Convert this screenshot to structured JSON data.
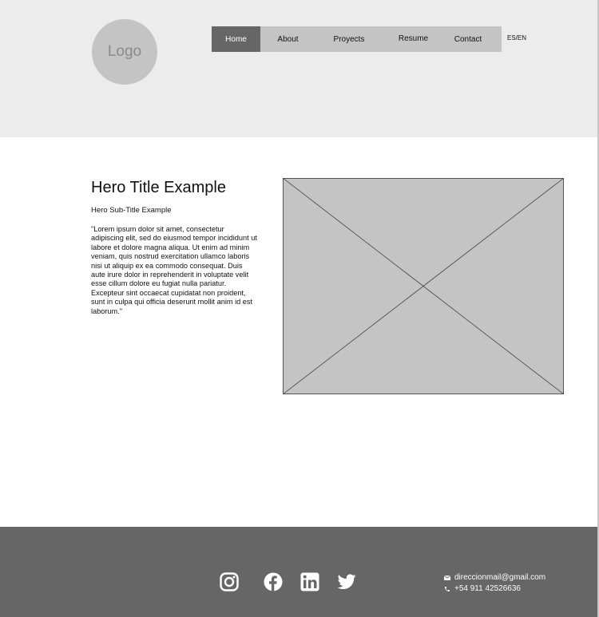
{
  "header": {
    "logo_text": "Logo",
    "nav": {
      "items": [
        {
          "label": "Home"
        },
        {
          "label": "About"
        },
        {
          "label": "Proyects"
        },
        {
          "label": "Resume"
        },
        {
          "label": "Contact"
        }
      ],
      "active": "Home"
    },
    "language_toggle": "ES/EN"
  },
  "hero": {
    "title": "Hero Title Example",
    "subtitle": "Hero Sub-Title Example",
    "body": "\"Lorem ipsum dolor sit amet, consectetur adipiscing elit, sed do eiusmod tempor incididunt ut labore et dolore magna aliqua. Ut enim ad minim veniam, quis nostrud exercitation ullamco laboris nisi ut aliquip ex ea commodo consequat. Duis aute irure dolor in reprehenderit in voluptate velit esse cillum dolore eu fugiat nulla pariatur. Excepteur sint occaecat cupidatat non proident, sunt in culpa qui officia deserunt mollit anim id est laborum.\"",
    "image_icon": "image-placeholder-icon"
  },
  "footer": {
    "social": [
      "instagram-icon",
      "facebook-icon",
      "linkedin-icon",
      "twitter-icon"
    ],
    "email": "direccionmail@gmail.com",
    "phone": "+54 911 42526636"
  },
  "colors": {
    "header_bg": "#ececec",
    "nav_bg": "#c4c4c4",
    "nav_active_bg": "#666666",
    "placeholder_gray": "#c4c4c4",
    "footer_bg": "#666666"
  }
}
